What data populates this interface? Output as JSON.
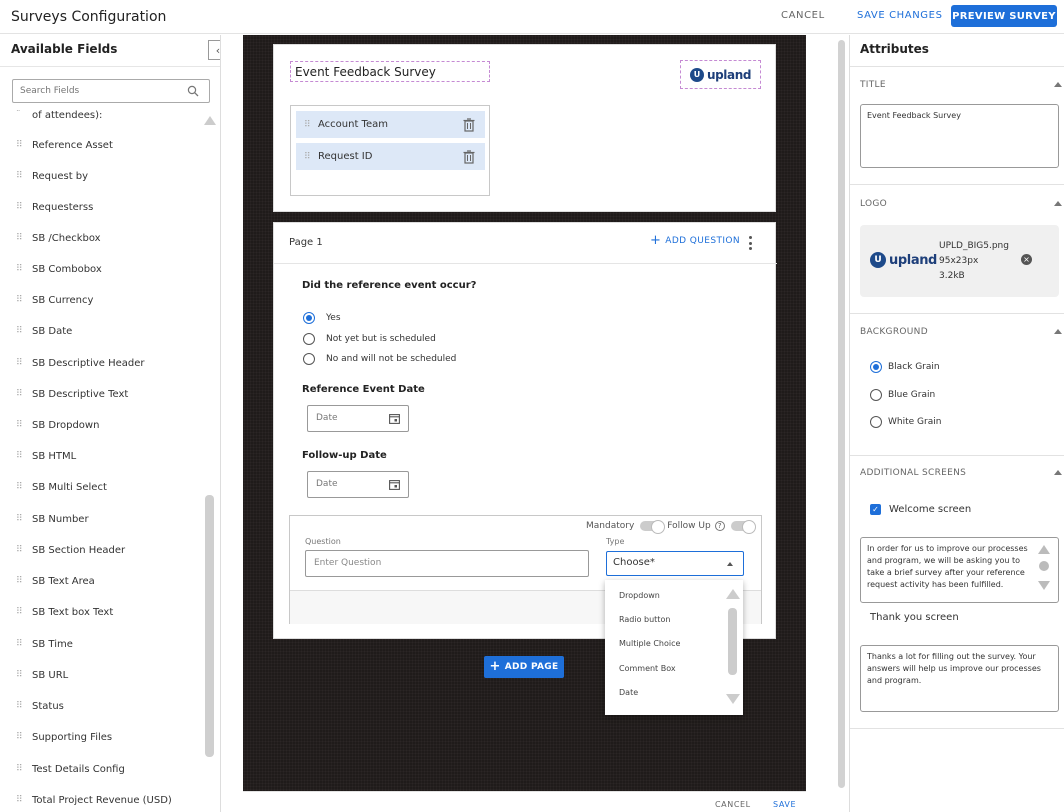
{
  "header": {
    "title": "Surveys Configuration",
    "cancel": "CANCEL",
    "save": "SAVE CHANGES",
    "preview": "PREVIEW SURVEY"
  },
  "left_panel": {
    "title": "Available Fields",
    "search_placeholder": "Search Fields",
    "fields": [
      "of attendees):",
      "Reference Asset",
      "Request by",
      "Requesterss",
      "SB /Checkbox",
      "SB Combobox",
      "SB Currency",
      "SB Date",
      "SB Descriptive Header",
      "SB Descriptive Text",
      "SB Dropdown",
      "SB HTML",
      "SB Multi Select",
      "SB Number",
      "SB Section Header",
      "SB Text Area",
      "SB Text box Text",
      "SB Time",
      "SB URL",
      "Status",
      "Supporting Files",
      "Test Details Config",
      "Total Project Revenue (USD)"
    ]
  },
  "survey": {
    "title": "Event Feedback Survey",
    "logo_text": "upland",
    "logo_letter": "U",
    "header_tags": [
      "Account Team",
      "Request ID"
    ],
    "page": {
      "label": "Page 1",
      "add_question": "ADD QUESTION",
      "q1": {
        "title": "Did the reference event occur?",
        "options": [
          "Yes",
          "Not yet but is scheduled",
          "No and will not be scheduled"
        ],
        "selected": 0
      },
      "q2": {
        "title": "Reference Event Date",
        "placeholder": "Date"
      },
      "q3": {
        "title": "Follow-up Date",
        "placeholder": "Date"
      },
      "editor": {
        "mandatory": "Mandatory",
        "follow_up": "Follow Up",
        "help": "?",
        "question_label": "Question",
        "question_placeholder": "Enter Question",
        "type_label": "Type",
        "type_value": "Choose*",
        "type_options": [
          "Dropdown",
          "Radio button",
          "Multiple Choice",
          "Comment Box",
          "Date"
        ]
      }
    },
    "add_page": "ADD PAGE",
    "footer_cancel": "CANCEL",
    "footer_save": "SAVE"
  },
  "attributes": {
    "title": "Attributes",
    "title_section": {
      "head": "TITLE",
      "value": "Event Feedback Survey"
    },
    "logo_section": {
      "head": "LOGO",
      "file_name": "UPLD_BIG5.png",
      "dimensions": "95x23px",
      "size": "3.2kB"
    },
    "background_section": {
      "head": "BACKGROUND",
      "options": [
        "Black Grain",
        "Blue Grain",
        "White Grain"
      ],
      "selected": 0
    },
    "additional_section": {
      "head": "ADDITIONAL SCREENS",
      "welcome_label": "Welcome screen",
      "welcome_text": "In order for us to improve our processes and program, we will be asking you to take a brief survey after your reference request activity has been fulfilled.",
      "thankyou_label": "Thank you screen",
      "thankyou_text": "Thanks a lot for filling out the survey. Your answers will help us improve our processes and program."
    }
  },
  "colors": {
    "accent": "#1e6fd9",
    "tag_bg": "#dde8f7",
    "canvas_bg": "#1f1b1a"
  }
}
